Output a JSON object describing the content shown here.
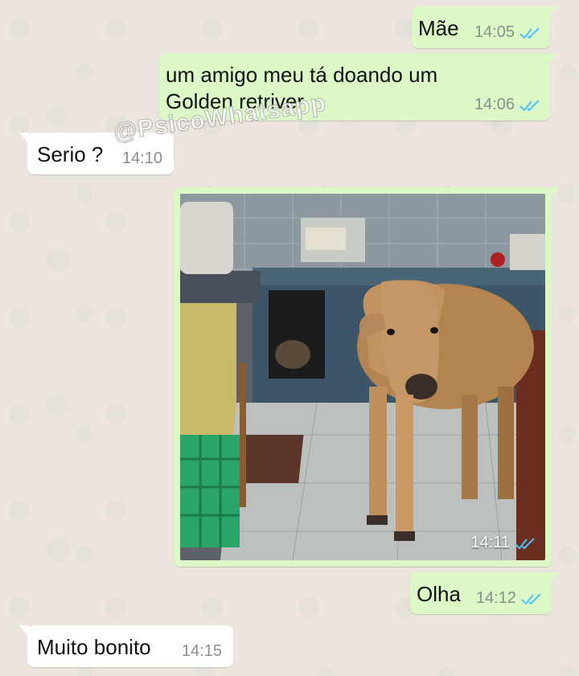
{
  "watermark": "@PsicoWhatsapp",
  "colors": {
    "outgoing_bubble": "#dcf8c6",
    "incoming_bubble": "#ffffff",
    "read_ticks": "#4fc3f7",
    "timestamp": "#8a8f8a"
  },
  "messages": [
    {
      "direction": "outgoing",
      "text": "Mãe",
      "time": "14:05",
      "status_icon": "double-check-read-icon"
    },
    {
      "direction": "outgoing",
      "text": "um amigo meu tá doando um Golden retriver",
      "time": "14:06",
      "status_icon": "double-check-read-icon"
    },
    {
      "direction": "incoming",
      "text": "Serio ?",
      "time": "14:10"
    },
    {
      "direction": "outgoing",
      "type": "image",
      "image": "calf-in-kitchen-photo",
      "time": "14:11",
      "status_icon": "double-check-read-icon"
    },
    {
      "direction": "outgoing",
      "text": "Olha",
      "time": "14:12",
      "status_icon": "double-check-read-icon"
    },
    {
      "direction": "incoming",
      "text": "Muito bonito",
      "time": "14:15"
    }
  ]
}
